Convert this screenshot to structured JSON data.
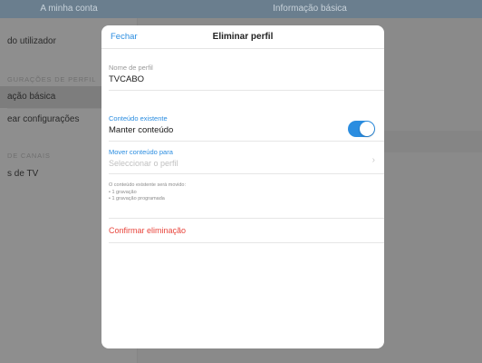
{
  "background": {
    "topbar": {
      "left_title": "A minha conta",
      "right_title": "Informação básica"
    },
    "sidebar": {
      "items": [
        {
          "label": "do utilizador"
        },
        {
          "label": "ação básica"
        },
        {
          "label": "ear configurações"
        },
        {
          "label": "s de TV"
        }
      ],
      "headers": [
        {
          "label": "GURAÇÕES DE PERFIL"
        },
        {
          "label": "DE CANAIS"
        }
      ]
    }
  },
  "modal": {
    "close_label": "Fechar",
    "title": "Eliminar perfil",
    "profile_name_label": "Nome de perfil",
    "profile_name_value": "TVCABO",
    "existing_content_label": "Conteúdo existente",
    "keep_content_label": "Manter conteúdo",
    "keep_content_enabled": true,
    "move_content_label": "Mover conteúdo para",
    "move_content_placeholder": "Seleccionar o perfil",
    "info_line1": "O conteúdo existente será movido:",
    "info_line2": "• 1 gravação",
    "info_line3": "• 1 gravação programada",
    "confirm_label": "Confirmar eliminação"
  },
  "colors": {
    "accent": "#2b8de0",
    "danger": "#e8453c",
    "overlay": "#8c8c8c"
  }
}
